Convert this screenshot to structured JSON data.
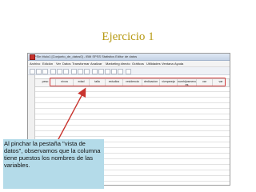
{
  "slide": {
    "title": "Ejercicio 1",
    "callout_text": "Al pinchar la pestaña \"vista de datos\", observamos que la columna tiene puestos los nombres de las variables."
  },
  "window": {
    "title": "*Sin título1 [Conjunto_de_datos0] - IBM SPSS Statistics Editor de datos",
    "menu": [
      "Archivo",
      "Edición",
      "Ver",
      "Datos",
      "Transformar",
      "Analizar",
      "Marketing directo",
      "Gráficos",
      "Utilidades",
      "Ventana",
      "Ayuda"
    ]
  },
  "grid": {
    "columns": [
      "peso",
      "nivva",
      "edad",
      "talla",
      "estudios",
      "residencia",
      "dedicacion",
      "vivepareja",
      "numhijosmenor es",
      "var",
      "var"
    ]
  },
  "colors": {
    "title": "#b79a14",
    "callout_bg": "#b4dbe9",
    "highlight": "#d23a3a"
  }
}
